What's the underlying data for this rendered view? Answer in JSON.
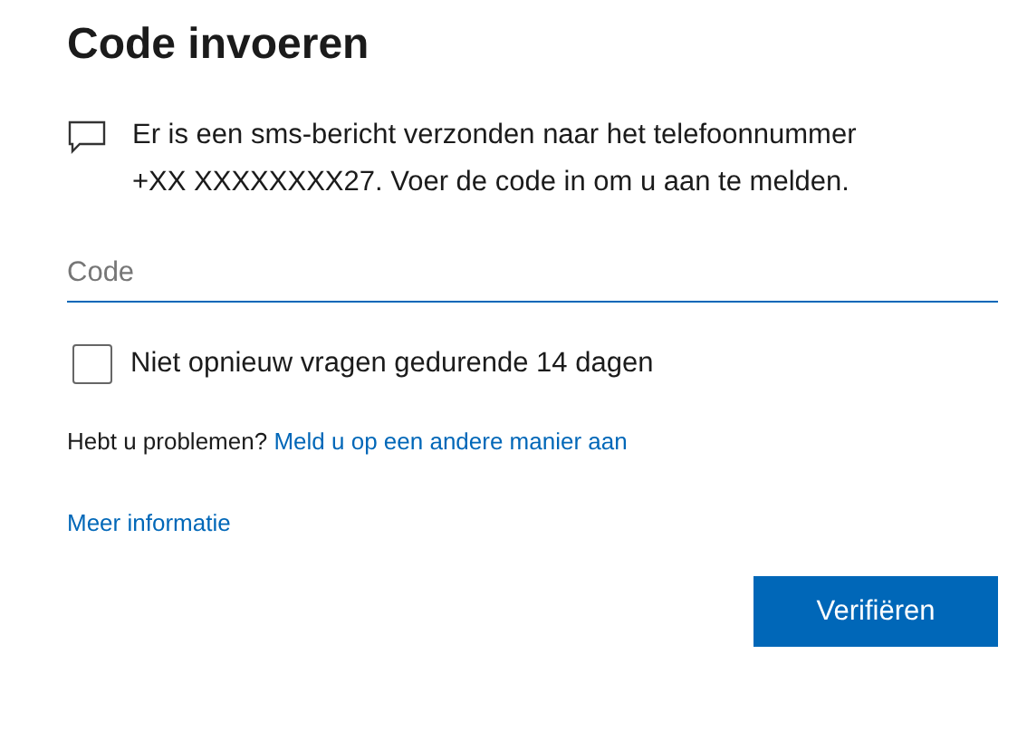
{
  "title": "Code invoeren",
  "message": "Er is een sms-bericht verzonden naar het telefoonnummer +XX XXXXXXXX27. Voer de code in om u aan te melden.",
  "code_field": {
    "placeholder": "Code"
  },
  "remember": {
    "label": "Niet opnieuw vragen gedurende 14 dagen",
    "checked": false
  },
  "trouble": {
    "text": "Hebt u problemen?",
    "link": "Meld u op een andere manier aan"
  },
  "more_info": "Meer informatie",
  "verify_button": "Verifiëren"
}
